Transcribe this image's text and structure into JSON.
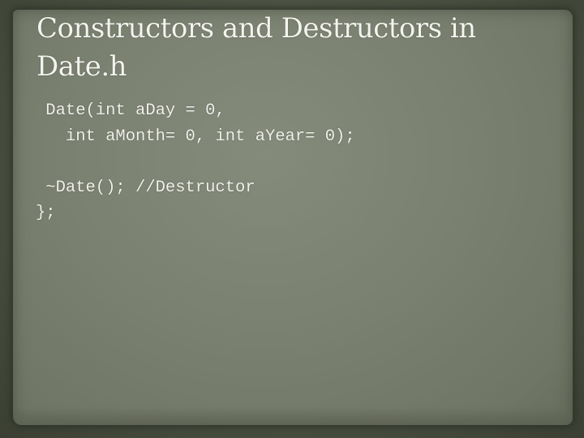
{
  "slide": {
    "title_line1": "Constructors and Destructors in",
    "title_line2": "Date.h",
    "code_lines": [
      " Date(int aDay = 0,",
      "   int aMonth= 0, int aYear= 0);",
      "",
      " ~Date(); //Destructor",
      "};"
    ]
  }
}
